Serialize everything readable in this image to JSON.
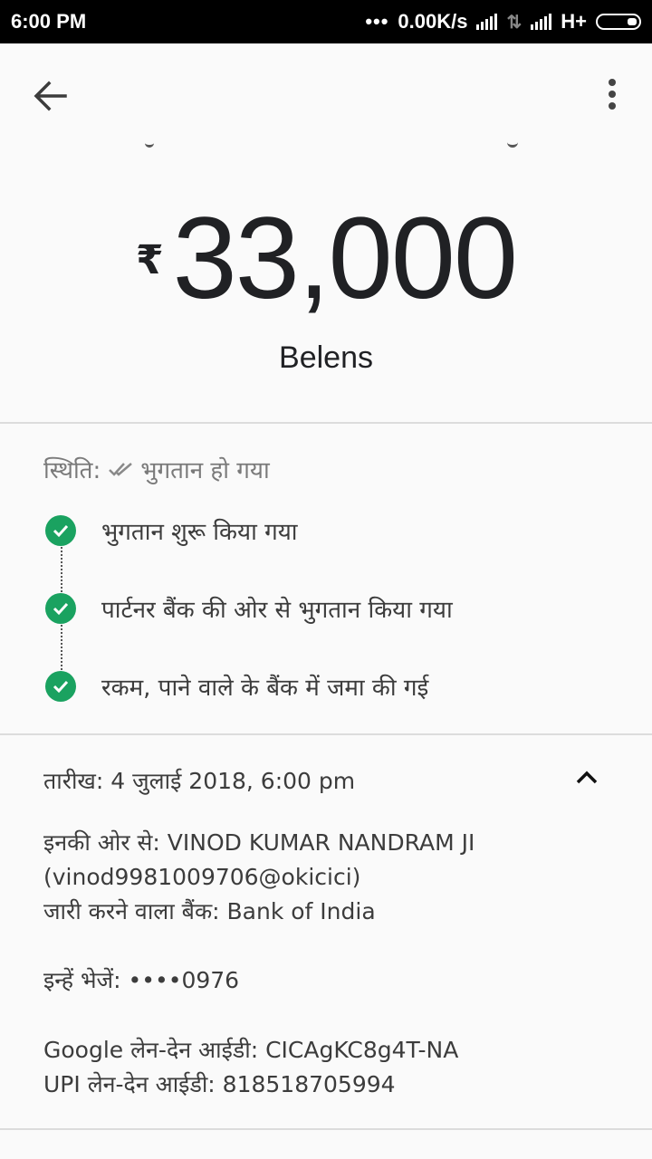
{
  "status_bar": {
    "time": "6:00 PM",
    "dots": "•••",
    "speed": "0.00K/s",
    "network": "H+"
  },
  "header": {
    "back_icon": "arrow-left-icon",
    "more_icon": "more-vert-icon"
  },
  "payment": {
    "currency_symbol": "₹",
    "amount": "33,000",
    "caption": "Belens"
  },
  "status": {
    "label": "स्थिति:",
    "value": "भुगतान हो गया",
    "steps": [
      {
        "text": "भुगतान शुरू किया गया"
      },
      {
        "text": "पार्टनर बैंक की ओर से भुगतान किया गया"
      },
      {
        "text": "रकम, पाने वाले के बैंक में जमा की गई"
      }
    ],
    "accent_color": "#1aa260"
  },
  "details": {
    "date": "तारीख: 4 जुलाई 2018, 6:00 pm",
    "from": "इनकी ओर से: VINOD KUMAR NANDRAM JI",
    "from_vpa": "(vinod9981009706@okicici)",
    "issuing_bank": "जारी करने वाला बैंक: Bank of India",
    "to": "इन्हें भेजें: ••••0976",
    "google_txn_id": "Google लेन-देन आईडी: CICAgKC8g4T-NA",
    "upi_txn_id": "UPI लेन-देन आईडी: 818518705994"
  }
}
